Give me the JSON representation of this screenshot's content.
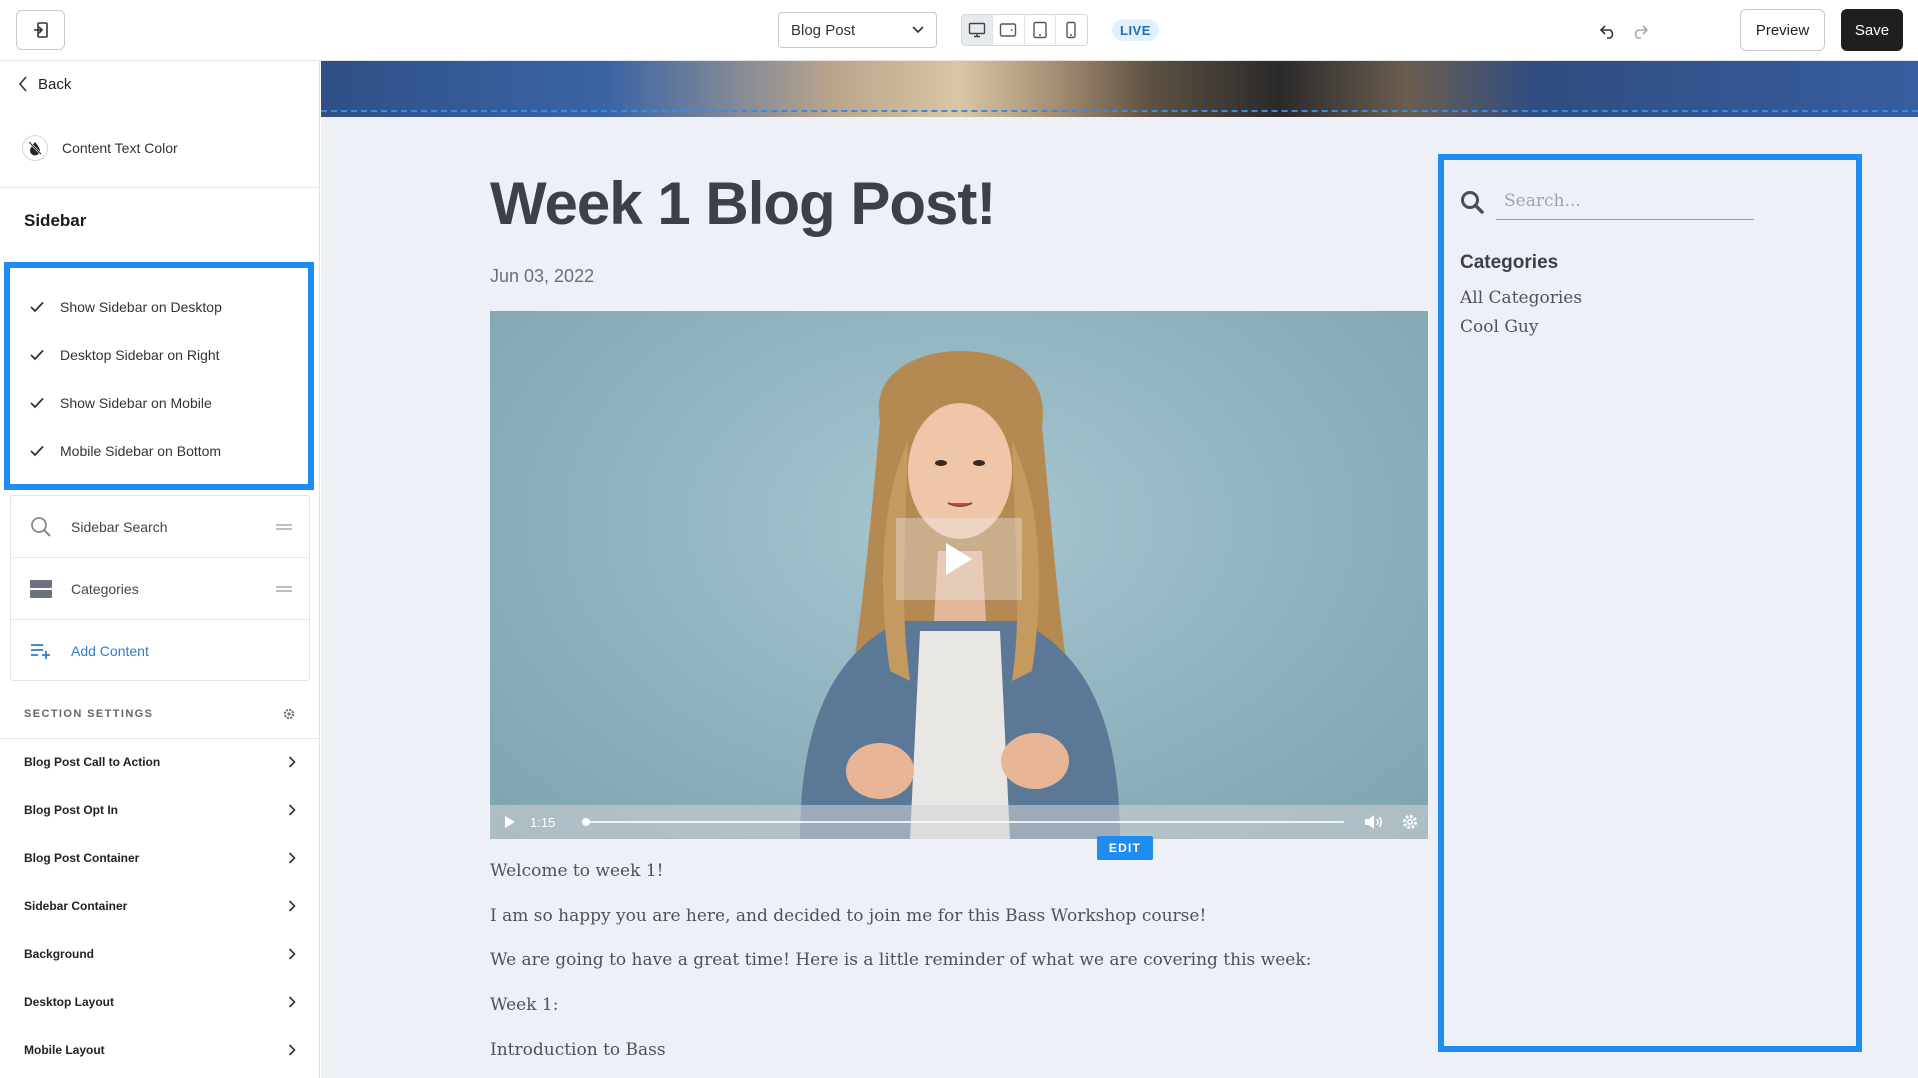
{
  "toolbar": {
    "page_select": "Blog Post",
    "live_badge": "LIVE",
    "preview_label": "Preview",
    "save_label": "Save",
    "device_active": "desktop"
  },
  "left_panel": {
    "back_label": "Back",
    "content_text_color_label": "Content Text Color",
    "sidebar_heading": "Sidebar",
    "checkboxes": [
      {
        "label": "Show Sidebar on Desktop",
        "checked": true
      },
      {
        "label": "Desktop Sidebar on Right",
        "checked": true
      },
      {
        "label": "Show Sidebar on Mobile",
        "checked": true
      },
      {
        "label": "Mobile Sidebar on Bottom",
        "checked": true
      }
    ],
    "content_items": [
      {
        "label": "Sidebar Search",
        "icon": "search-icon"
      },
      {
        "label": "Categories",
        "icon": "categories-block-icon"
      }
    ],
    "add_content_label": "Add Content",
    "section_settings_label": "SECTION SETTINGS",
    "settings": [
      "Blog Post Call to Action",
      "Blog Post Opt In",
      "Blog Post Container",
      "Sidebar Container",
      "Background",
      "Desktop Layout",
      "Mobile Layout"
    ]
  },
  "post": {
    "title": "Week 1 Blog Post!",
    "date": "Jun 03, 2022",
    "video_time": "1:15",
    "edit_label": "EDIT",
    "paragraphs": [
      "Welcome to week 1!",
      "I am so happy you are here, and decided to join me for this Bass Workshop course!",
      "We are going to have a great time! Here is a little reminder of what we are covering this week:",
      "Week 1:",
      "Introduction to Bass"
    ]
  },
  "blog_sidebar": {
    "search_placeholder": "Search...",
    "categories_heading": "Categories",
    "categories": [
      "All Categories",
      "Cool Guy"
    ]
  },
  "colors": {
    "accent_blue": "#1e8cf0",
    "canvas_bg": "#edf1f7",
    "save_bg": "#1f1f1f",
    "link_blue": "#2d7dc9"
  }
}
